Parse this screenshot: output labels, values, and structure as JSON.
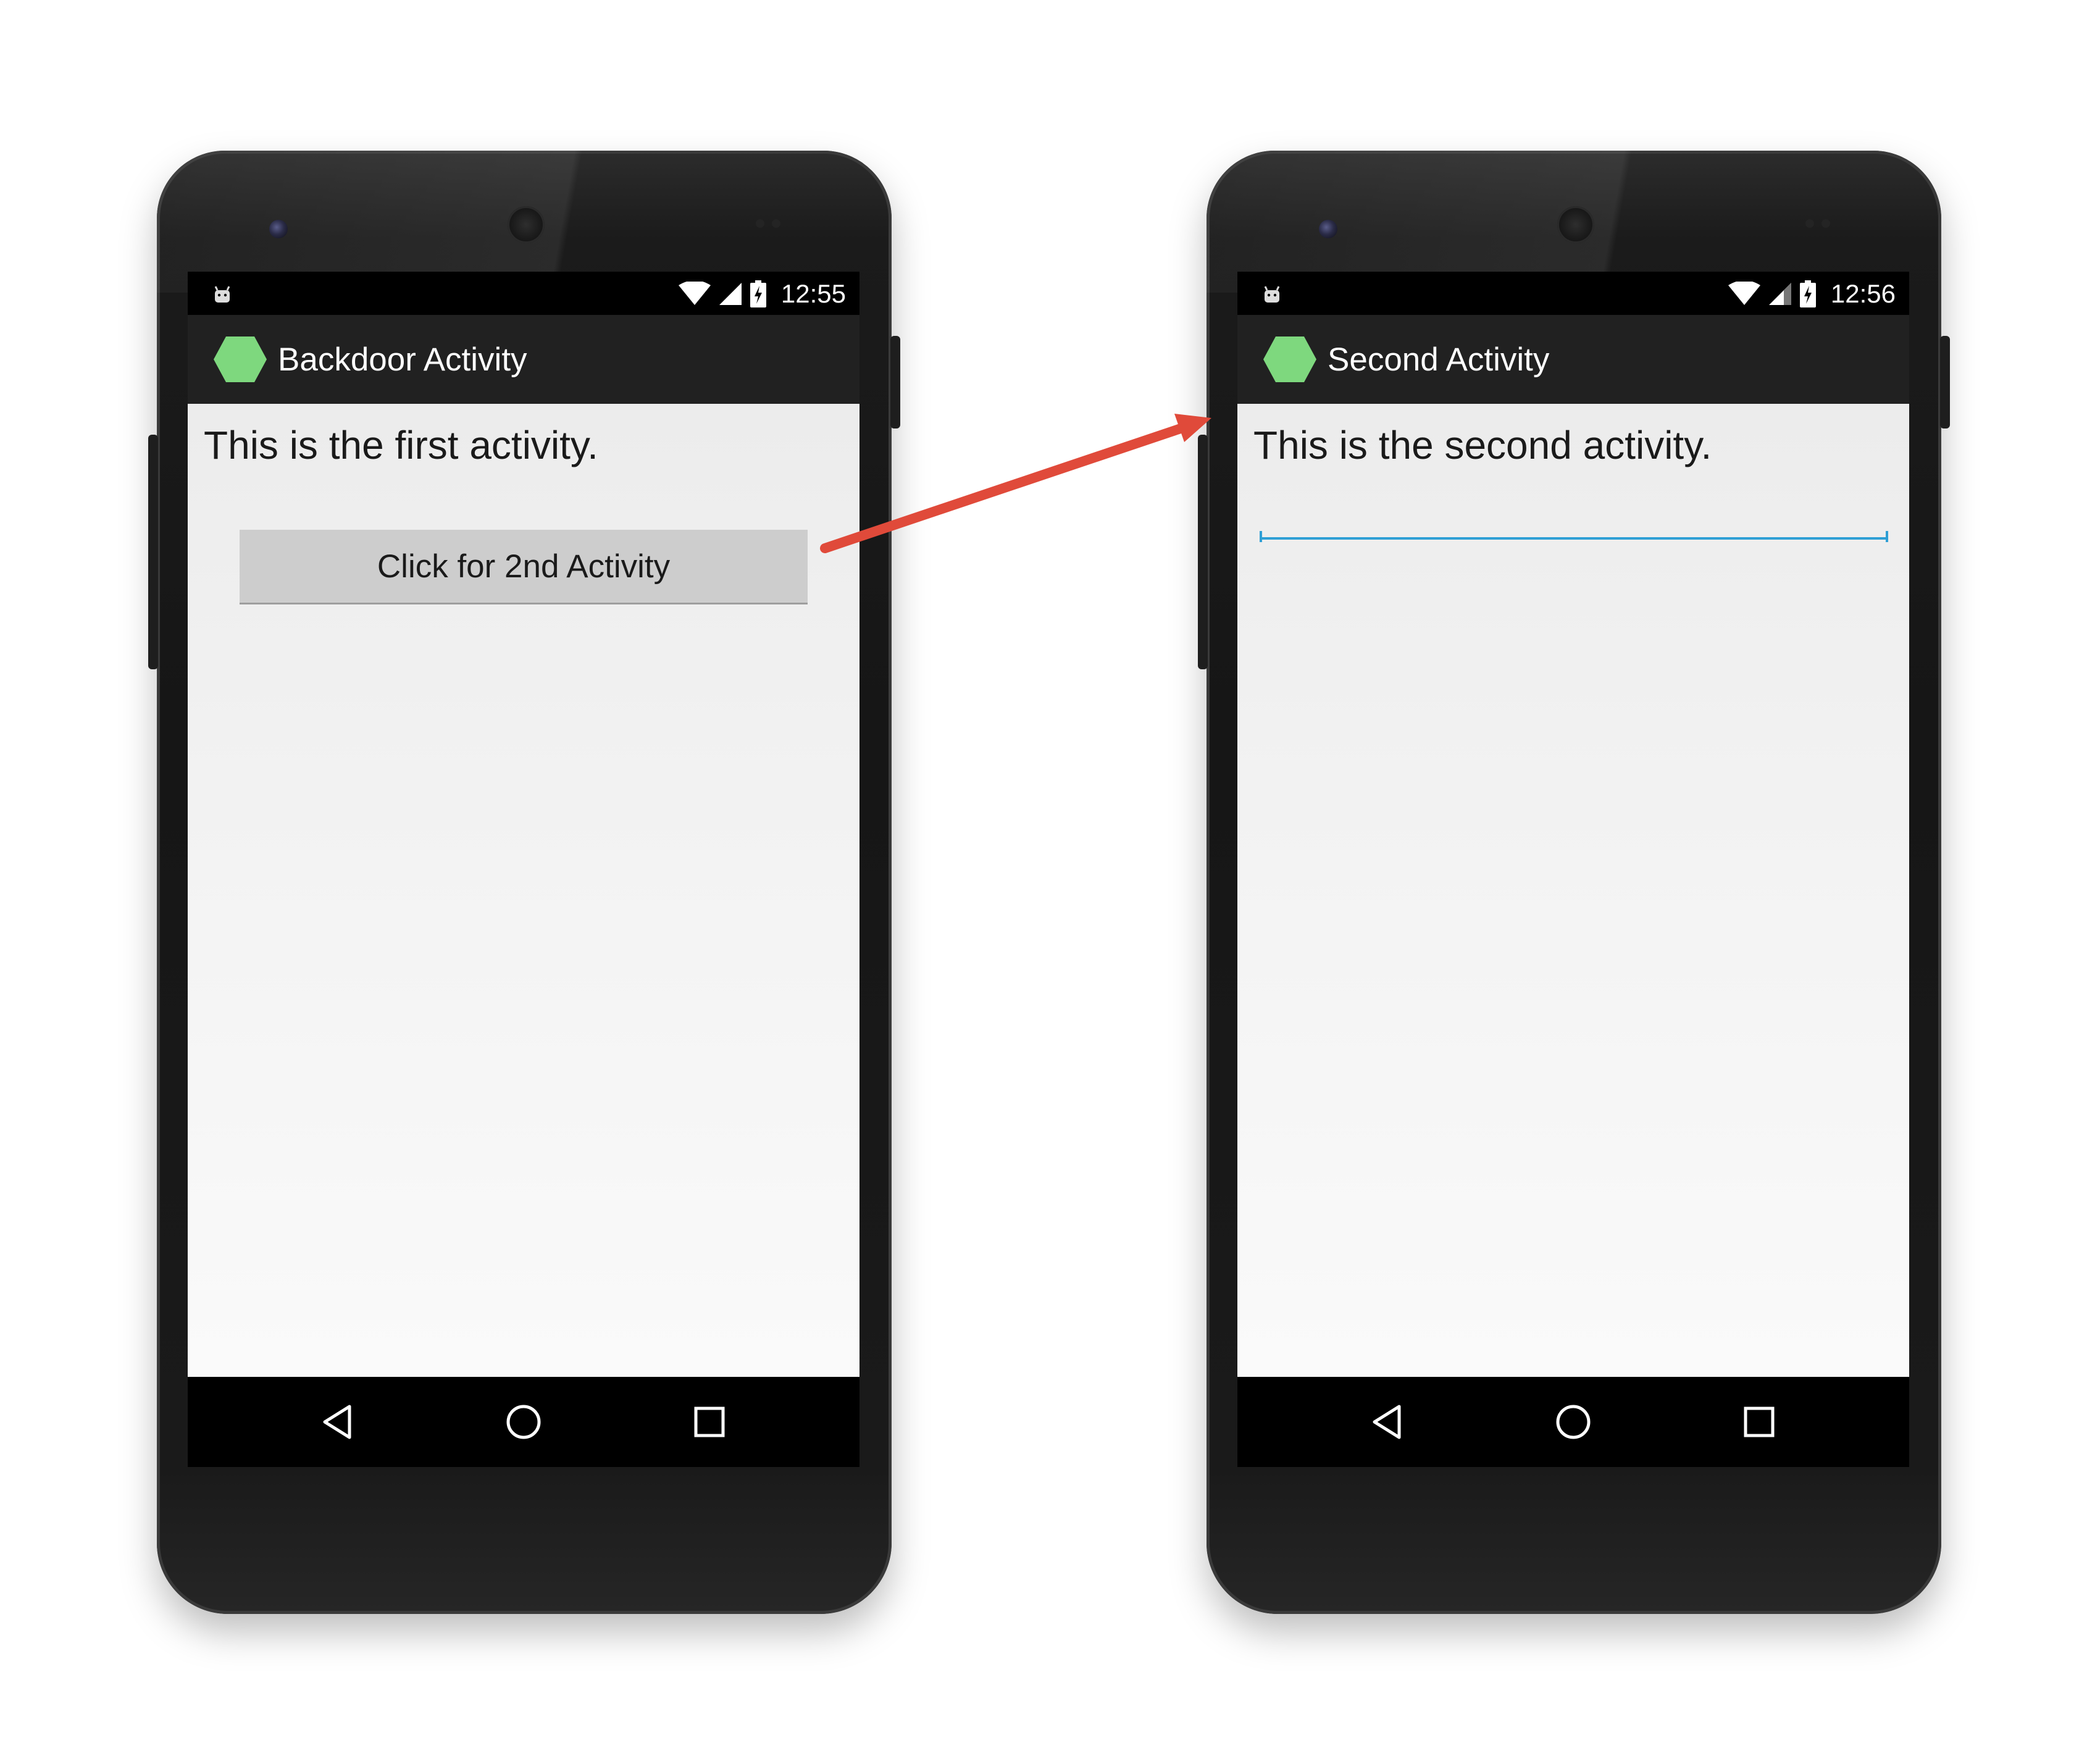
{
  "colors": {
    "accent_field_underline": "#2f9fd5",
    "app_icon_green": "#7ed87e",
    "arrow_red": "#e04a3a",
    "action_bar": "#212121",
    "button_gray": "#cdcdcd"
  },
  "phones": [
    {
      "status_bar": {
        "time": "12:55",
        "icons": [
          "android-notification-icon",
          "wifi-icon",
          "cell-signal-icon",
          "battery-charging-icon"
        ]
      },
      "action_bar": {
        "app_icon": "hexagon-app-icon",
        "title": "Backdoor Activity"
      },
      "content": {
        "text": "This is the first activity.",
        "button_label": "Click for 2nd Activity"
      },
      "nav_bar": {
        "icons": [
          "back-icon",
          "home-icon",
          "recent-apps-icon"
        ]
      }
    },
    {
      "status_bar": {
        "time": "12:56",
        "icons": [
          "android-notification-icon",
          "wifi-icon",
          "cell-signal-icon",
          "battery-charging-icon"
        ]
      },
      "action_bar": {
        "app_icon": "hexagon-app-icon",
        "title": "Second Activity"
      },
      "content": {
        "text": "This is the second activity.",
        "input_value": ""
      },
      "nav_bar": {
        "icons": [
          "back-icon",
          "home-icon",
          "recent-apps-icon"
        ]
      }
    }
  ]
}
